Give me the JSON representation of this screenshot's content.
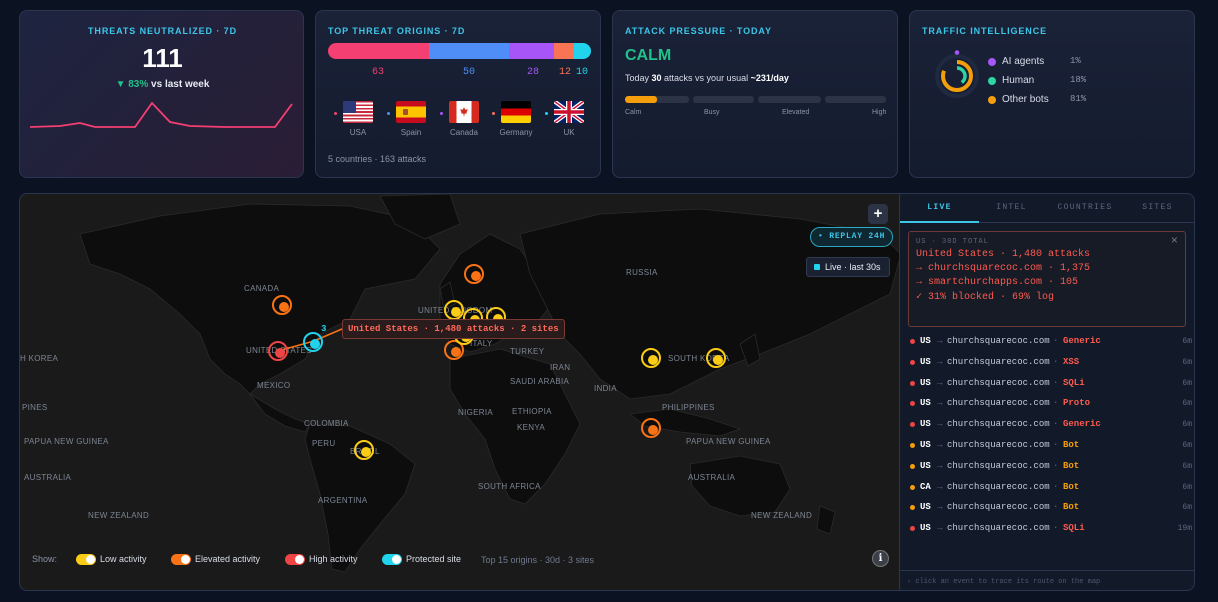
{
  "colors": {
    "low": "#facc15",
    "elevated": "#f97316",
    "high": "#ef4444",
    "protected": "#22d3ee",
    "accent": "#3cc6e8",
    "calm": "#22c08a"
  },
  "threats": {
    "title": "THREATS NEUTRALIZED · 7D",
    "value": "111",
    "delta_arrow": "▼",
    "delta": "83%",
    "delta_suffix": "vs last week"
  },
  "origins": {
    "title": "TOP THREAT ORIGINS · 7D",
    "segments": [
      {
        "value": "63",
        "color": "#f43f72"
      },
      {
        "value": "50",
        "color": "#4f8ef7"
      },
      {
        "value": "28",
        "color": "#a855f7"
      },
      {
        "value": "12",
        "color": "#f97355"
      },
      {
        "value": "10",
        "color": "#22d3ee"
      }
    ],
    "countries": [
      {
        "name": "USA",
        "dot": "#f43f72",
        "flag": "us-flag-icon"
      },
      {
        "name": "Spain",
        "dot": "#4f8ef7",
        "flag": "spain-flag-icon"
      },
      {
        "name": "Canada",
        "dot": "#a855f7",
        "flag": "canada-flag-icon"
      },
      {
        "name": "Germany",
        "dot": "#f97355",
        "flag": "germany-flag-icon"
      },
      {
        "name": "UK",
        "dot": "#22d3ee",
        "flag": "uk-flag-icon"
      }
    ],
    "summary": "5 countries · 163 attacks"
  },
  "pressure": {
    "title": "ATTACK PRESSURE · TODAY",
    "status": "CALM",
    "line_pre": "Today ",
    "line_attacks": "30",
    "line_mid": " attacks vs your usual ",
    "line_usual": "~231/day",
    "levels": [
      "Calm",
      "Busy",
      "Elevated",
      "High"
    ],
    "fill_fraction": 0.5
  },
  "traffic": {
    "title": "TRAFFIC INTELLIGENCE",
    "items": [
      {
        "label": "AI agents",
        "pct": "1%",
        "color": "#a855f7",
        "value": 1
      },
      {
        "label": "Human",
        "pct": "18%",
        "color": "#2dd4a4",
        "value": 18
      },
      {
        "label": "Other bots",
        "pct": "81%",
        "color": "#f59e0b",
        "value": 81
      }
    ]
  },
  "map": {
    "labels": [
      "CANADA",
      "RUSSIA",
      "UNITED STATES",
      "MEXICO",
      "UNITED KINGDOM",
      "TURKEY",
      "IRAN",
      "SAUDI ARABIA",
      "INDIA",
      "NIGERIA",
      "ETHIOPIA",
      "KENYA",
      "COLOMBIA",
      "PERU",
      "BRAZIL",
      "ARGENTINA",
      "SOUTH AFRICA",
      "SOUTH KOREA",
      "PHILIPPINES",
      "PAPUA NEW GUINEA",
      "AUSTRALIA",
      "NEW ZEALAND",
      "ITALY",
      "PINES",
      "H KOREA"
    ],
    "replay_label": "REPLAY 24H",
    "live_label": "Live · last 30s",
    "tooltip": "United States · 1,480 attacks · 2 sites",
    "cluster_count": "3",
    "zoom_in": "+",
    "info": "i",
    "show_label": "Show:",
    "legend": [
      {
        "label": "Low activity",
        "color": "#facc15"
      },
      {
        "label": "Elevated activity",
        "color": "#f97316"
      },
      {
        "label": "High activity",
        "color": "#ef4444"
      },
      {
        "label": "Protected site",
        "color": "#22d3ee"
      }
    ],
    "footnote": "Top 15 origins · 30d · 3 sites"
  },
  "panel": {
    "tabs": [
      "LIVE",
      "INTEL",
      "COUNTRIES",
      "SITES"
    ],
    "detail": {
      "header": "US · 30D TOTAL",
      "close": "×",
      "lines": [
        "United States · 1,480 attacks",
        "→ churchsquarecoc.com · 1,375",
        "→ smartchurchapps.com · 105",
        "✓ 31% blocked · 69% log"
      ]
    },
    "events": [
      {
        "country": "US",
        "site": "churchsquarecoc.com",
        "type": "Generic",
        "time": "6m",
        "dot": "#ef4444",
        "color": "#ff5a4e"
      },
      {
        "country": "US",
        "site": "churchsquarecoc.com",
        "type": "XSS",
        "time": "6m",
        "dot": "#ef4444",
        "color": "#ff5a4e"
      },
      {
        "country": "US",
        "site": "churchsquarecoc.com",
        "type": "SQLi",
        "time": "6m",
        "dot": "#ef4444",
        "color": "#ff5a4e"
      },
      {
        "country": "US",
        "site": "churchsquarecoc.com",
        "type": "Proto",
        "time": "6m",
        "dot": "#ef4444",
        "color": "#ff5a4e"
      },
      {
        "country": "US",
        "site": "churchsquarecoc.com",
        "type": "Generic",
        "time": "6m",
        "dot": "#ef4444",
        "color": "#ff5a4e"
      },
      {
        "country": "US",
        "site": "churchsquarecoc.com",
        "type": "Bot",
        "time": "6m",
        "dot": "#f59e0b",
        "color": "#f59e0b"
      },
      {
        "country": "US",
        "site": "churchsquarecoc.com",
        "type": "Bot",
        "time": "6m",
        "dot": "#f59e0b",
        "color": "#f59e0b"
      },
      {
        "country": "CA",
        "site": "churchsquarecoc.com",
        "type": "Bot",
        "time": "6m",
        "dot": "#f59e0b",
        "color": "#f59e0b"
      },
      {
        "country": "US",
        "site": "churchsquarecoc.com",
        "type": "Bot",
        "time": "6m",
        "dot": "#f59e0b",
        "color": "#f59e0b"
      },
      {
        "country": "US",
        "site": "churchsquarecoc.com",
        "type": "SQLi",
        "time": "19m",
        "dot": "#ef4444",
        "color": "#ff5a4e"
      }
    ],
    "footer": "› click an event to trace its route on the map"
  }
}
